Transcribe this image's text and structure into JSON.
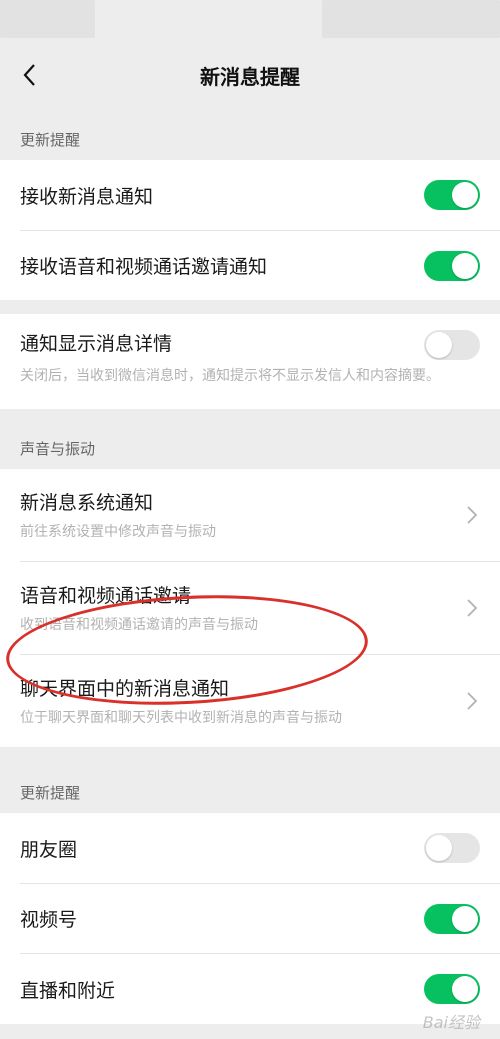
{
  "nav": {
    "title": "新消息提醒",
    "back_icon": "chevron-left-icon"
  },
  "sections": {
    "update1": {
      "header": "更新提醒"
    },
    "sound": {
      "header": "声音与振动"
    },
    "update2": {
      "header": "更新提醒"
    }
  },
  "rows": {
    "receive_new": {
      "label": "接收新消息通知",
      "toggle": "on"
    },
    "receive_call": {
      "label": "接收语音和视频通话邀请通知",
      "toggle": "on"
    },
    "show_detail": {
      "label": "通知显示消息详情",
      "toggle": "off",
      "desc": "关闭后，当收到微信消息时，通知提示将不显示发信人和内容摘要。"
    },
    "system_notify": {
      "label": "新消息系统通知",
      "desc": "前往系统设置中修改声音与振动"
    },
    "call_invite": {
      "label": "语音和视频通话邀请",
      "desc": "收到语音和视频通话邀请的声音与振动"
    },
    "chat_notify": {
      "label": "聊天界面中的新消息通知",
      "desc": "位于聊天界面和聊天列表中收到新消息的声音与振动"
    },
    "moments": {
      "label": "朋友圈",
      "toggle": "off"
    },
    "channels": {
      "label": "视频号",
      "toggle": "on"
    },
    "live_nearby": {
      "label": "直播和附近",
      "toggle": "on"
    }
  },
  "colors": {
    "toggle_on": "#07c160",
    "toggle_off": "#e5e5e5",
    "annotation": "#d9302a"
  },
  "watermark": "Bai经验"
}
